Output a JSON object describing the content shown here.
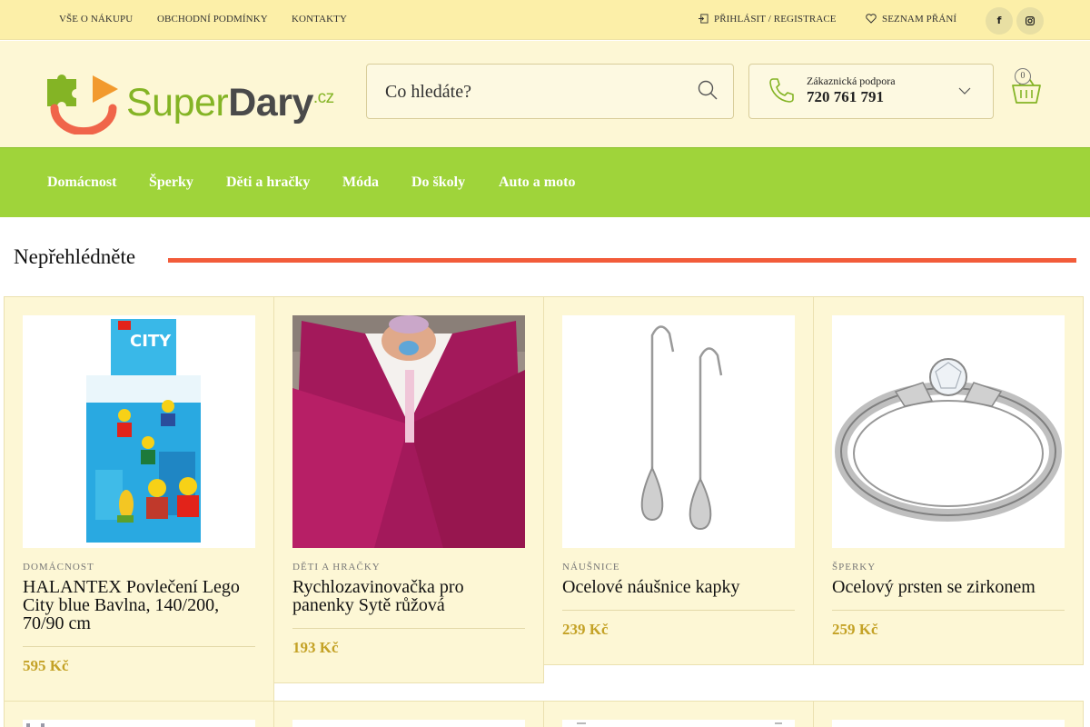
{
  "topbar": {
    "links": [
      "VŠE O NÁKUPU",
      "OBCHODNÍ PODMÍNKY",
      "KONTAKTY"
    ],
    "login": "PŘIHLÁSIT / REGISTRACE",
    "wishlist": "SEZNAM PŘÁNÍ",
    "social": {
      "facebook": "f",
      "instagram": "instagram-icon"
    }
  },
  "header": {
    "logo": {
      "super": "Super",
      "dary": "Dary",
      "cz": ".cz"
    },
    "search_placeholder": "Co hledáte?",
    "support_label": "Zákaznická podpora",
    "support_phone": "720 761 791",
    "cart_count": "0"
  },
  "nav": {
    "items": [
      "Domácnost",
      "Šperky",
      "Děti a hračky",
      "Móda",
      "Do školy",
      "Auto a moto"
    ]
  },
  "section": {
    "title": "Nepřehlédněte"
  },
  "products": [
    {
      "category": "DOMÁCNOST",
      "title": "HALANTEX Povlečení Lego City blue Bavlna, 140/200, 70/90 cm",
      "price": "595 Kč",
      "image": "lego-city-bedding",
      "image_text": "CITY"
    },
    {
      "category": "DĚTI A HRAČKY",
      "title": "Rychlozavinovačka pro panenky Sytě růžová",
      "price": "193 Kč",
      "image": "doll-swaddle"
    },
    {
      "category": "NÁUŠNICE",
      "title": "Ocelové náušnice kapky",
      "price": "239 Kč",
      "image": "drop-earrings"
    },
    {
      "category": "ŠPERKY",
      "title": "Ocelový prsten se zirkonem",
      "price": "259 Kč",
      "image": "zircon-ring"
    }
  ],
  "colors": {
    "accent_green": "#9fd43a",
    "price_gold": "#c4a226",
    "section_line": "#f25c3a",
    "topbar_bg": "#fcefa8"
  }
}
